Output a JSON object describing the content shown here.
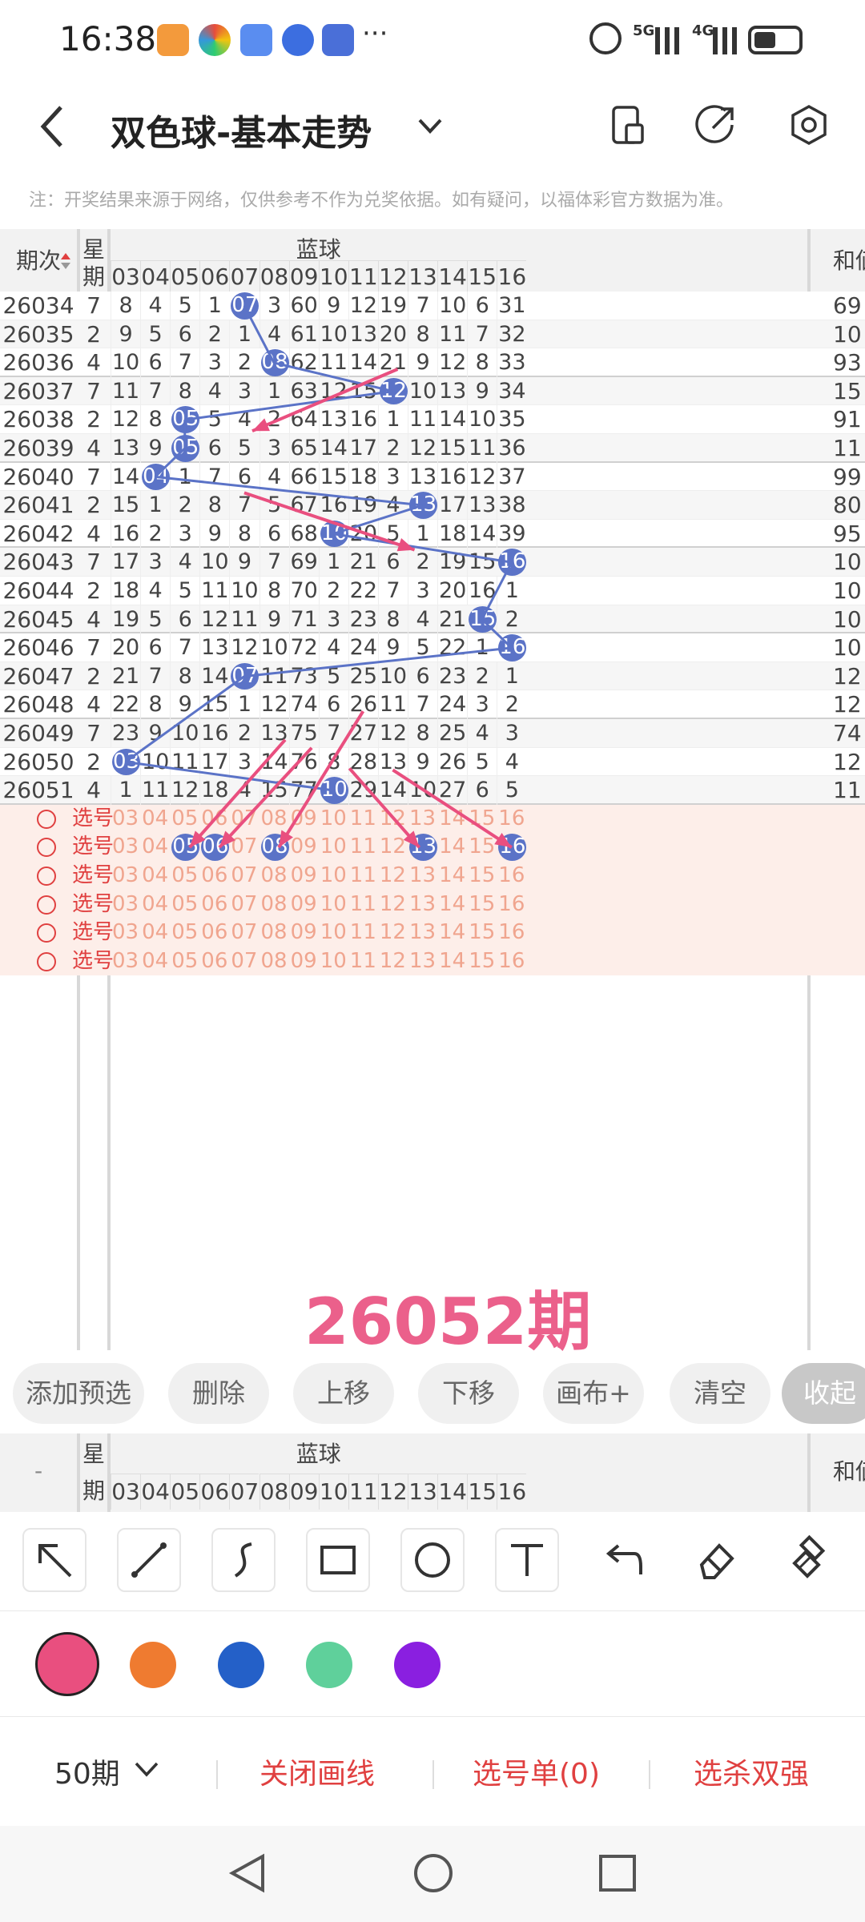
{
  "status_bar": {
    "time": "16:38",
    "more": "···",
    "network_5g": "5G",
    "network_4g": "4G",
    "icons": [
      "app-icon-orange",
      "app-icon-multicolor",
      "chat-icon",
      "browser-icon",
      "wallet-icon",
      "alarm-icon",
      "signal-icon",
      "battery-icon"
    ]
  },
  "header": {
    "title": "双色球-基本走势",
    "icons": [
      "back-icon",
      "dropdown-chevron-icon",
      "phone-icon",
      "share-icon",
      "settings-icon"
    ]
  },
  "notice": "注：开奖结果来源于网络，仅供参考不作为兑奖依据。如有疑问，以福体彩官方数据为准。",
  "table": {
    "col_issue": "期次",
    "col_week_1": "星",
    "col_week_2": "期",
    "group_blue": "蓝球",
    "col_sum_partial": "和値",
    "blue_numbers": [
      "03",
      "04",
      "05",
      "06",
      "07",
      "08",
      "09",
      "10",
      "11",
      "12",
      "13",
      "14",
      "15",
      "16"
    ],
    "rows": [
      {
        "issue": "26034",
        "week": "7",
        "cells": [
          "8",
          "4",
          "5",
          "1",
          "07",
          "3",
          "60",
          "9",
          "12",
          "19",
          "7",
          "10",
          "6",
          "31"
        ],
        "sum": "69",
        "hit": 4
      },
      {
        "issue": "26035",
        "week": "2",
        "cells": [
          "9",
          "5",
          "6",
          "2",
          "1",
          "4",
          "61",
          "10",
          "13",
          "20",
          "8",
          "11",
          "7",
          "32"
        ],
        "sum": "10",
        "hit": -1
      },
      {
        "issue": "26036",
        "week": "4",
        "cells": [
          "10",
          "6",
          "7",
          "3",
          "2",
          "08",
          "62",
          "11",
          "14",
          "21",
          "9",
          "12",
          "8",
          "33"
        ],
        "sum": "93",
        "hit": 5
      },
      {
        "issue": "26037",
        "week": "7",
        "cells": [
          "11",
          "7",
          "8",
          "4",
          "3",
          "1",
          "63",
          "12",
          "15",
          "12",
          "10",
          "13",
          "9",
          "34"
        ],
        "sum": "15",
        "hit": 9
      },
      {
        "issue": "26038",
        "week": "2",
        "cells": [
          "12",
          "8",
          "05",
          "5",
          "4",
          "2",
          "64",
          "13",
          "16",
          "1",
          "11",
          "14",
          "10",
          "35"
        ],
        "sum": "91",
        "hit": 2
      },
      {
        "issue": "26039",
        "week": "4",
        "cells": [
          "13",
          "9",
          "05",
          "6",
          "5",
          "3",
          "65",
          "14",
          "17",
          "2",
          "12",
          "15",
          "11",
          "36"
        ],
        "sum": "11",
        "hit": 2
      },
      {
        "issue": "26040",
        "week": "7",
        "cells": [
          "14",
          "04",
          "1",
          "7",
          "6",
          "4",
          "66",
          "15",
          "18",
          "3",
          "13",
          "16",
          "12",
          "37"
        ],
        "sum": "99",
        "hit": 1
      },
      {
        "issue": "26041",
        "week": "2",
        "cells": [
          "15",
          "1",
          "2",
          "8",
          "7",
          "5",
          "67",
          "16",
          "19",
          "4",
          "13",
          "17",
          "13",
          "38"
        ],
        "sum": "80",
        "hit": 10
      },
      {
        "issue": "26042",
        "week": "4",
        "cells": [
          "16",
          "2",
          "3",
          "9",
          "8",
          "6",
          "68",
          "10",
          "20",
          "5",
          "1",
          "18",
          "14",
          "39"
        ],
        "sum": "95",
        "hit": 7
      },
      {
        "issue": "26043",
        "week": "7",
        "cells": [
          "17",
          "3",
          "4",
          "10",
          "9",
          "7",
          "69",
          "1",
          "21",
          "6",
          "2",
          "19",
          "15",
          "16"
        ],
        "sum": "10",
        "hit": 13
      },
      {
        "issue": "26044",
        "week": "2",
        "cells": [
          "18",
          "4",
          "5",
          "11",
          "10",
          "8",
          "70",
          "2",
          "22",
          "7",
          "3",
          "20",
          "16",
          "1"
        ],
        "sum": "10",
        "hit": -1
      },
      {
        "issue": "26045",
        "week": "4",
        "cells": [
          "19",
          "5",
          "6",
          "12",
          "11",
          "9",
          "71",
          "3",
          "23",
          "8",
          "4",
          "21",
          "15",
          "2"
        ],
        "sum": "10",
        "hit": 12
      },
      {
        "issue": "26046",
        "week": "7",
        "cells": [
          "20",
          "6",
          "7",
          "13",
          "12",
          "10",
          "72",
          "4",
          "24",
          "9",
          "5",
          "22",
          "1",
          "16"
        ],
        "sum": "10",
        "hit": 13
      },
      {
        "issue": "26047",
        "week": "2",
        "cells": [
          "21",
          "7",
          "8",
          "14",
          "07",
          "11",
          "73",
          "5",
          "25",
          "10",
          "6",
          "23",
          "2",
          "1"
        ],
        "sum": "12",
        "hit": 4
      },
      {
        "issue": "26048",
        "week": "4",
        "cells": [
          "22",
          "8",
          "9",
          "15",
          "1",
          "12",
          "74",
          "6",
          "26",
          "11",
          "7",
          "24",
          "3",
          "2"
        ],
        "sum": "12",
        "hit": -1
      },
      {
        "issue": "26049",
        "week": "7",
        "cells": [
          "23",
          "9",
          "10",
          "16",
          "2",
          "13",
          "75",
          "7",
          "27",
          "12",
          "8",
          "25",
          "4",
          "3"
        ],
        "sum": "74",
        "hit": -1
      },
      {
        "issue": "26050",
        "week": "2",
        "cells": [
          "03",
          "10",
          "11",
          "17",
          "3",
          "14",
          "76",
          "8",
          "28",
          "13",
          "9",
          "26",
          "5",
          "4"
        ],
        "sum": "12",
        "hit": 0
      },
      {
        "issue": "26051",
        "week": "4",
        "cells": [
          "1",
          "11",
          "12",
          "18",
          "4",
          "15",
          "77",
          "10",
          "29",
          "14",
          "10",
          "27",
          "6",
          "5"
        ],
        "sum": "11",
        "hit": 7
      }
    ],
    "pick_label": "选号",
    "pick_rows": 6,
    "picked_row": 1,
    "picked_numbers": [
      "05",
      "06",
      "08",
      "13",
      "16"
    ],
    "watermark": "26052期"
  },
  "actions": [
    "添加预选",
    "删除",
    "上移",
    "下移",
    "画布+",
    "清空",
    "收起"
  ],
  "footer_header": {
    "col_issue": "-",
    "col_week_1": "星",
    "col_week_2": "期",
    "group_blue": "蓝球",
    "col_sum_partial": "和値"
  },
  "drawing_tools": [
    "arrow-tool-icon",
    "line-tool-icon",
    "curve-tool-icon",
    "rectangle-tool-icon",
    "circle-tool-icon",
    "text-tool-icon",
    "undo-icon",
    "eraser-icon",
    "clear-brush-icon"
  ],
  "colors": {
    "selected": "#e94f7f",
    "palette": [
      "#e94f7f",
      "#ef7b30",
      "#2460c8",
      "#5fd09b",
      "#8a1fe0"
    ],
    "ball": "#5b73c7",
    "line": "#5b73c7",
    "arrow": "#e94f7f",
    "accent_red": "#e04040",
    "pick_bg": "#fdeee9"
  },
  "bottom_bar": {
    "period": "50期",
    "close_lines": "关闭画线",
    "pick_list": "选号单(0)",
    "kill": "选杀双强"
  },
  "nav": [
    "back-nav-icon",
    "home-nav-icon",
    "recents-nav-icon"
  ]
}
